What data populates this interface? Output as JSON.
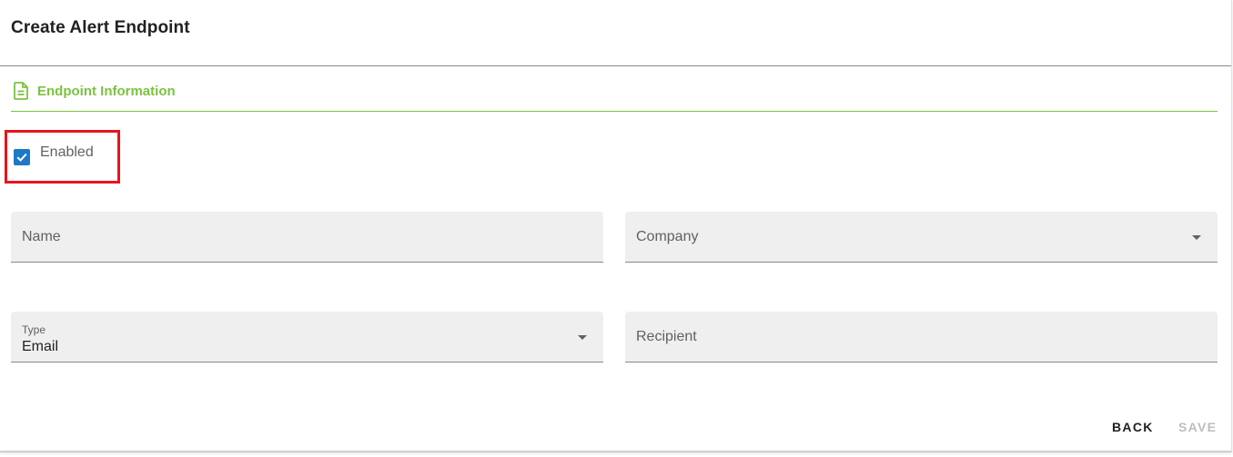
{
  "page": {
    "title": "Create Alert Endpoint"
  },
  "section": {
    "title": "Endpoint Information",
    "icon": "document-icon",
    "accent_color": "#7cc241"
  },
  "enabled_checkbox": {
    "label": "Enabled",
    "checked": true,
    "color": "#1e78c8"
  },
  "fields": {
    "name": {
      "label": "Name",
      "value": ""
    },
    "company": {
      "label": "Company",
      "value": ""
    },
    "type": {
      "label": "Type",
      "value": "Email"
    },
    "recipient": {
      "label": "Recipient",
      "value": ""
    }
  },
  "actions": {
    "back_label": "BACK",
    "save_label": "SAVE",
    "save_disabled": true
  }
}
